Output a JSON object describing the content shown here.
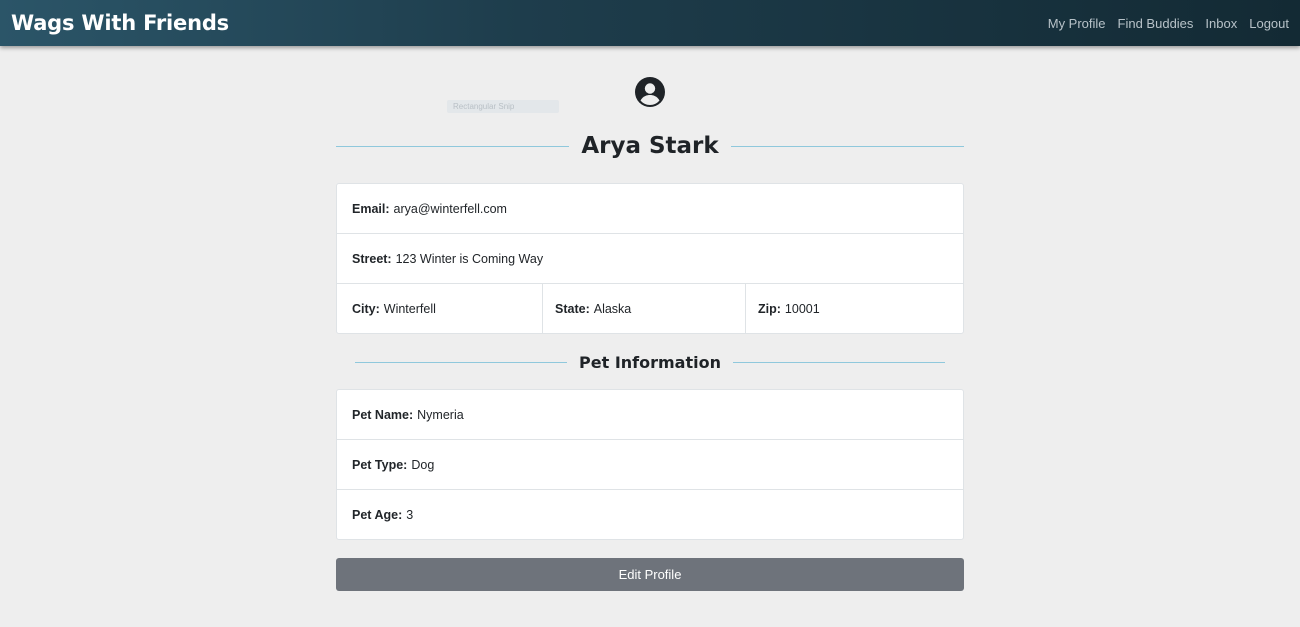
{
  "navbar": {
    "brand": "Wags With Friends",
    "links": [
      "My Profile",
      "Find Buddies",
      "Inbox",
      "Logout"
    ]
  },
  "ghost_chip": "Rectangular Snip",
  "profile": {
    "icon": "user-circle-icon",
    "name": "Arya Stark",
    "email_label": "Email:",
    "email": "arya@winterfell.com",
    "street_label": "Street:",
    "street": "123 Winter is Coming Way",
    "city_label": "City:",
    "city": "Winterfell",
    "state_label": "State:",
    "state": "Alaska",
    "zip_label": "Zip:",
    "zip": "10001"
  },
  "pet": {
    "heading": "Pet Information",
    "name_label": "Pet Name:",
    "name": "Nymeria",
    "type_label": "Pet Type:",
    "type": "Dog",
    "age_label": "Pet Age:",
    "age": "3"
  },
  "actions": {
    "edit_label": "Edit Profile"
  },
  "colors": {
    "navbar_start": "#2b5568",
    "navbar_end": "#132a34",
    "page_bg": "#eeeeee",
    "divider_line": "#8fc8dc",
    "button_bg": "#6e737b"
  }
}
